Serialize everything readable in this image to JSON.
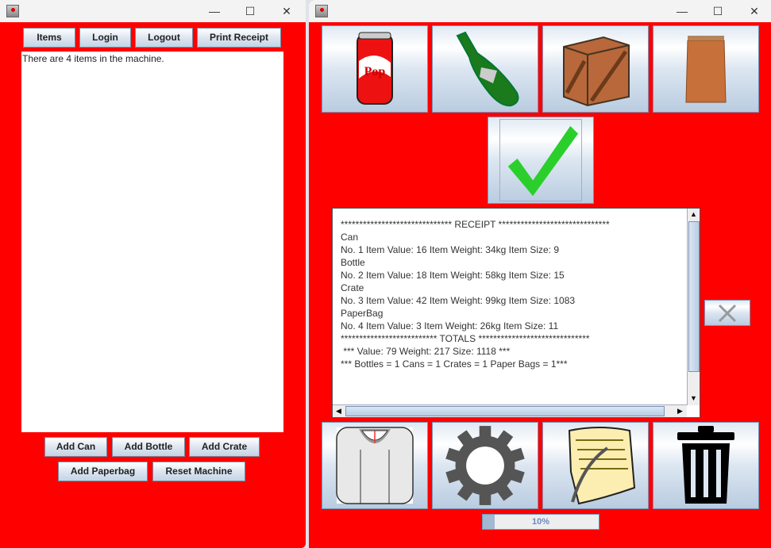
{
  "left_window": {
    "title_controls": {
      "minimize": "—",
      "maximize": "☐",
      "close": "✕"
    },
    "toolbar": {
      "items": "Items",
      "login": "Login",
      "logout": "Logout",
      "print_receipt": "Print Receipt"
    },
    "output_text": "There are 4 items in the machine.",
    "buttons": {
      "add_can": "Add Can",
      "add_bottle": "Add Bottle",
      "add_crate": "Add Crate",
      "add_paperbag": "Add Paperbag",
      "reset_machine": "Reset Machine"
    }
  },
  "right_window": {
    "title_controls": {
      "minimize": "—",
      "maximize": "☐",
      "close": "✕"
    },
    "item_buttons": [
      {
        "icon": "pop-can-icon",
        "label": "Pop"
      },
      {
        "icon": "bottle-icon"
      },
      {
        "icon": "crate-icon"
      },
      {
        "icon": "paper-bag-icon"
      }
    ],
    "confirm_icon": "checkmark-icon",
    "receipt_lines": [
      "****************************** RECEIPT ******************************",
      "Can",
      "No. 1 Item Value: 16 Item Weight: 34kg Item Size: 9",
      "Bottle",
      "No. 2 Item Value: 18 Item Weight: 58kg Item Size: 15",
      "Crate",
      "No. 3 Item Value: 42 Item Weight: 99kg Item Size: 1083",
      "PaperBag",
      "No. 4 Item Value: 3 Item Weight: 26kg Item Size: 11",
      "************************** TOTALS ******************************",
      " *** Value: 79 Weight: 217 Size: 1118 ***",
      "*** Bottles = 1 Cans = 1 Crates = 1 Paper Bags = 1***"
    ],
    "bottom_buttons": [
      {
        "icon": "scale-icon"
      },
      {
        "icon": "gear-icon"
      },
      {
        "icon": "scroll-quill-icon"
      },
      {
        "icon": "trash-icon"
      }
    ],
    "progress": {
      "percent": 10,
      "label": "10%"
    },
    "colors": {
      "background": "#ff0000",
      "progress_fill": "#a3b8d1"
    }
  }
}
